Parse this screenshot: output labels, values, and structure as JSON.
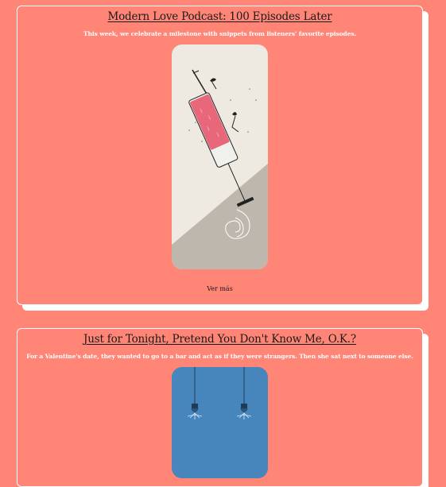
{
  "articles": [
    {
      "title": "Modern Love Podcast: 100 Episodes Later",
      "description": "This week, we celebrate a milestone with snippets from listeners' favorite episodes.",
      "more_label": "Ver más",
      "image_icon": "syringe-illustration-icon"
    },
    {
      "title": "Just for Tonight, Pretend You Don't Know Me, O.K.?",
      "description": "For a Valentine's date, they wanted to go to a bar and act as if they were strangers. Then she sat next to someone else.",
      "image_icon": "hanging-lightbulbs-illustration-icon"
    }
  ],
  "colors": {
    "background": "#ff8577",
    "card_border": "#ffffff",
    "title_text": "#1a1a1a",
    "desc_text": "#ffffff"
  }
}
